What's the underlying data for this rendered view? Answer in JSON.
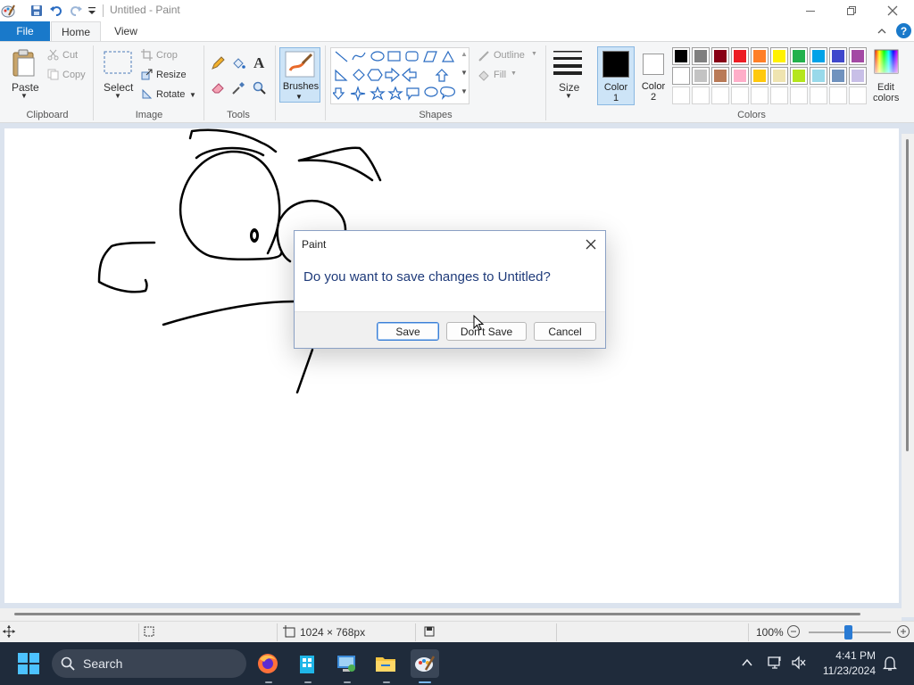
{
  "window": {
    "title": "Untitled - Paint"
  },
  "tabs": {
    "file": "File",
    "home": "Home",
    "view": "View"
  },
  "ribbon": {
    "clipboard": {
      "paste": "Paste",
      "cut": "Cut",
      "copy": "Copy",
      "label": "Clipboard"
    },
    "image": {
      "select": "Select",
      "crop": "Crop",
      "resize": "Resize",
      "rotate": "Rotate",
      "label": "Image"
    },
    "tools": {
      "label": "Tools"
    },
    "brushes": {
      "label": "Brushes"
    },
    "shapes": {
      "outline": "Outline",
      "fill": "Fill",
      "label": "Shapes"
    },
    "size": {
      "label": "Size"
    },
    "color1": {
      "label": "Color",
      "num": "1"
    },
    "color2": {
      "label": "Color",
      "num": "2"
    },
    "edit_colors": {
      "line1": "Edit",
      "line2": "colors"
    },
    "colors": {
      "label": "Colors"
    }
  },
  "palette": {
    "row1": [
      "#000000",
      "#7f7f7f",
      "#880015",
      "#ed1c24",
      "#ff7f27",
      "#fff200",
      "#22b14c",
      "#00a2e8",
      "#3f48cc",
      "#a349a4"
    ],
    "row2": [
      "#ffffff",
      "#c3c3c3",
      "#b97a57",
      "#ffaec9",
      "#ffc90e",
      "#efe4b0",
      "#b5e61d",
      "#99d9ea",
      "#7092be",
      "#c8bfe7"
    ],
    "color1_value": "#000000",
    "color2_value": "#ffffff"
  },
  "statusbar": {
    "dimensions": "1024 × 768px",
    "zoom": "100%"
  },
  "dialog": {
    "title": "Paint",
    "message": "Do you want to save changes to Untitled?",
    "save": "Save",
    "dont_save": "Don't Save",
    "cancel": "Cancel"
  },
  "taskbar": {
    "search": "Search",
    "time": "4:41 PM",
    "date": "11/23/2024"
  }
}
